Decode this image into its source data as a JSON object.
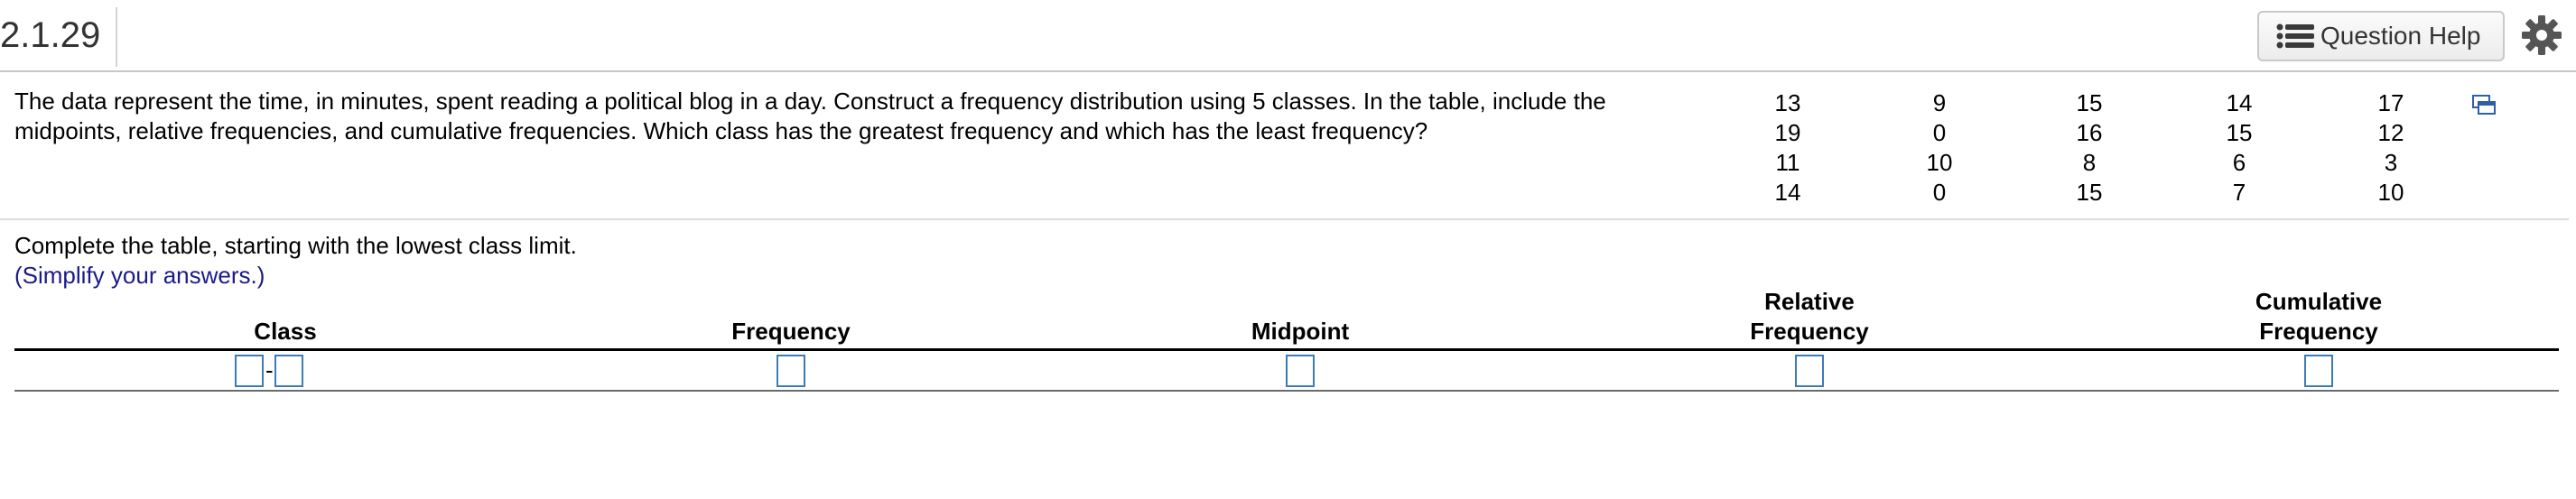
{
  "header": {
    "question_number": "2.1.29",
    "help_label": "Question Help"
  },
  "question": {
    "text_line1": "The data represent the time, in minutes, spent reading a political blog in a day. Construct a frequency distribution using 5 classes. In the table, include the",
    "text_line2": "midpoints, relative frequencies, and cumulative frequencies. Which class has the greatest frequency and which has the least frequency?"
  },
  "data_table": {
    "rows": [
      [
        "13",
        "9",
        "15",
        "14",
        "17"
      ],
      [
        "19",
        "0",
        "16",
        "15",
        "12"
      ],
      [
        "11",
        "10",
        "8",
        "6",
        "3"
      ],
      [
        "14",
        "0",
        "15",
        "7",
        "10"
      ]
    ]
  },
  "instructions": {
    "line1": "Complete the table, starting with the lowest class limit.",
    "line2": "(Simplify your answers.)"
  },
  "answer_table": {
    "class_header": "Class",
    "frequency_header": "Frequency",
    "midpoint_header": "Midpoint",
    "relative_header_1": "Relative",
    "relative_header_2": "Frequency",
    "cumulative_header_1": "Cumulative",
    "cumulative_header_2": "Frequency",
    "class_separator": "-",
    "inputs": {
      "class_lower": "",
      "class_upper": "",
      "frequency": "",
      "midpoint": "",
      "relative_frequency": "",
      "cumulative_frequency": ""
    }
  },
  "colors": {
    "input_border": "#3b7cb8",
    "instruction_blue": "#1a1a8c",
    "copy_icon": "#2f5fa8"
  }
}
